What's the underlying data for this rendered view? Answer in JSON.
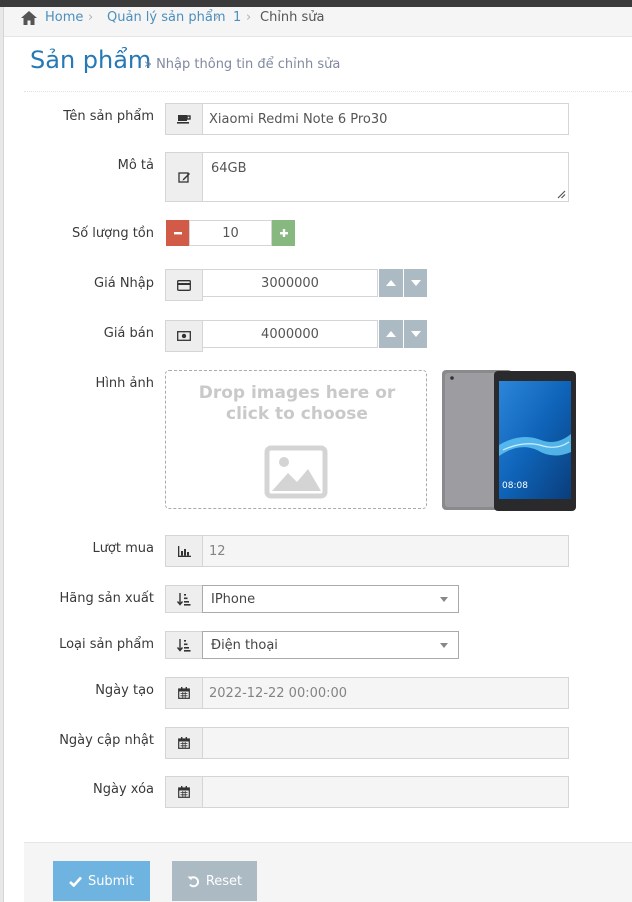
{
  "breadcrumb": {
    "home": "Home",
    "products": "Quản lý sản phẩm",
    "id": "1",
    "current": "Chỉnh sửa"
  },
  "header": {
    "title": "Sản phẩm",
    "subtitle": "» Nhập thông tin để chỉnh sửa"
  },
  "form": {
    "name": {
      "label": "Tên sản phẩm",
      "value": "Xiaomi Redmi Note 6 Pro30",
      "icon": "coffee-icon"
    },
    "description": {
      "label": "Mô tả",
      "value": "64GB",
      "icon": "edit-icon"
    },
    "stock": {
      "label": "Số lượng tồn",
      "value": "10"
    },
    "import_price": {
      "label": "Giá Nhập",
      "value": "3000000",
      "icon": "credit-card-icon"
    },
    "sale_price": {
      "label": "Giá bán",
      "value": "4000000",
      "icon": "money-icon"
    },
    "image": {
      "label": "Hình ảnh",
      "dropzone_text": "Drop images here or click to choose",
      "thumb_time": "08:08"
    },
    "purchases": {
      "label": "Lượt mua",
      "value": "12",
      "icon": "bar-chart-icon"
    },
    "manufacturer": {
      "label": "Hãng sản xuất",
      "value": "IPhone",
      "icon": "sort-amount-icon"
    },
    "category": {
      "label": "Loại sản phẩm",
      "value": "Điện thoại",
      "icon": "sort-amount-icon"
    },
    "created_at": {
      "label": "Ngày tạo",
      "value": "2022-12-22 00:00:00",
      "icon": "calendar-icon"
    },
    "updated_at": {
      "label": "Ngày cập nhật",
      "value": "",
      "icon": "calendar-icon"
    },
    "deleted_at": {
      "label": "Ngày xóa",
      "value": "",
      "icon": "calendar-icon"
    }
  },
  "actions": {
    "submit": "Submit",
    "reset": "Reset"
  },
  "colors": {
    "primary": "#6fb3e0",
    "danger": "#d15b47",
    "success": "#87b87f",
    "grey": "#abbac3",
    "title_blue": "#2679b5"
  }
}
